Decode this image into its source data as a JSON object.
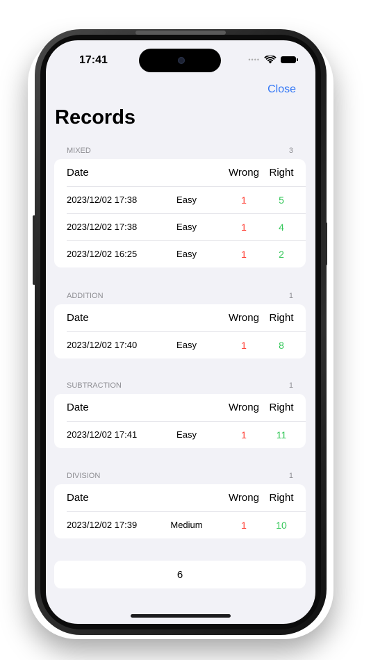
{
  "status": {
    "time": "17:41"
  },
  "nav": {
    "close_label": "Close",
    "title": "Records"
  },
  "table_headers": {
    "date": "Date",
    "wrong": "Wrong",
    "right": "Right"
  },
  "sections": [
    {
      "name": "MIXED",
      "count": "3",
      "rows": [
        {
          "date": "2023/12/02 17:38",
          "difficulty": "Easy",
          "wrong": "1",
          "right": "5"
        },
        {
          "date": "2023/12/02 17:38",
          "difficulty": "Easy",
          "wrong": "1",
          "right": "4"
        },
        {
          "date": "2023/12/02 16:25",
          "difficulty": "Easy",
          "wrong": "1",
          "right": "2"
        }
      ]
    },
    {
      "name": "ADDITION",
      "count": "1",
      "rows": [
        {
          "date": "2023/12/02 17:40",
          "difficulty": "Easy",
          "wrong": "1",
          "right": "8"
        }
      ]
    },
    {
      "name": "SUBTRACTION",
      "count": "1",
      "rows": [
        {
          "date": "2023/12/02 17:41",
          "difficulty": "Easy",
          "wrong": "1",
          "right": "11"
        }
      ]
    },
    {
      "name": "DIVISION",
      "count": "1",
      "rows": [
        {
          "date": "2023/12/02 17:39",
          "difficulty": "Medium",
          "wrong": "1",
          "right": "10"
        }
      ]
    }
  ],
  "total": "6",
  "colors": {
    "accent": "#3478f6",
    "wrong": "#ff3b30",
    "right": "#34c759",
    "background": "#f2f2f7"
  }
}
